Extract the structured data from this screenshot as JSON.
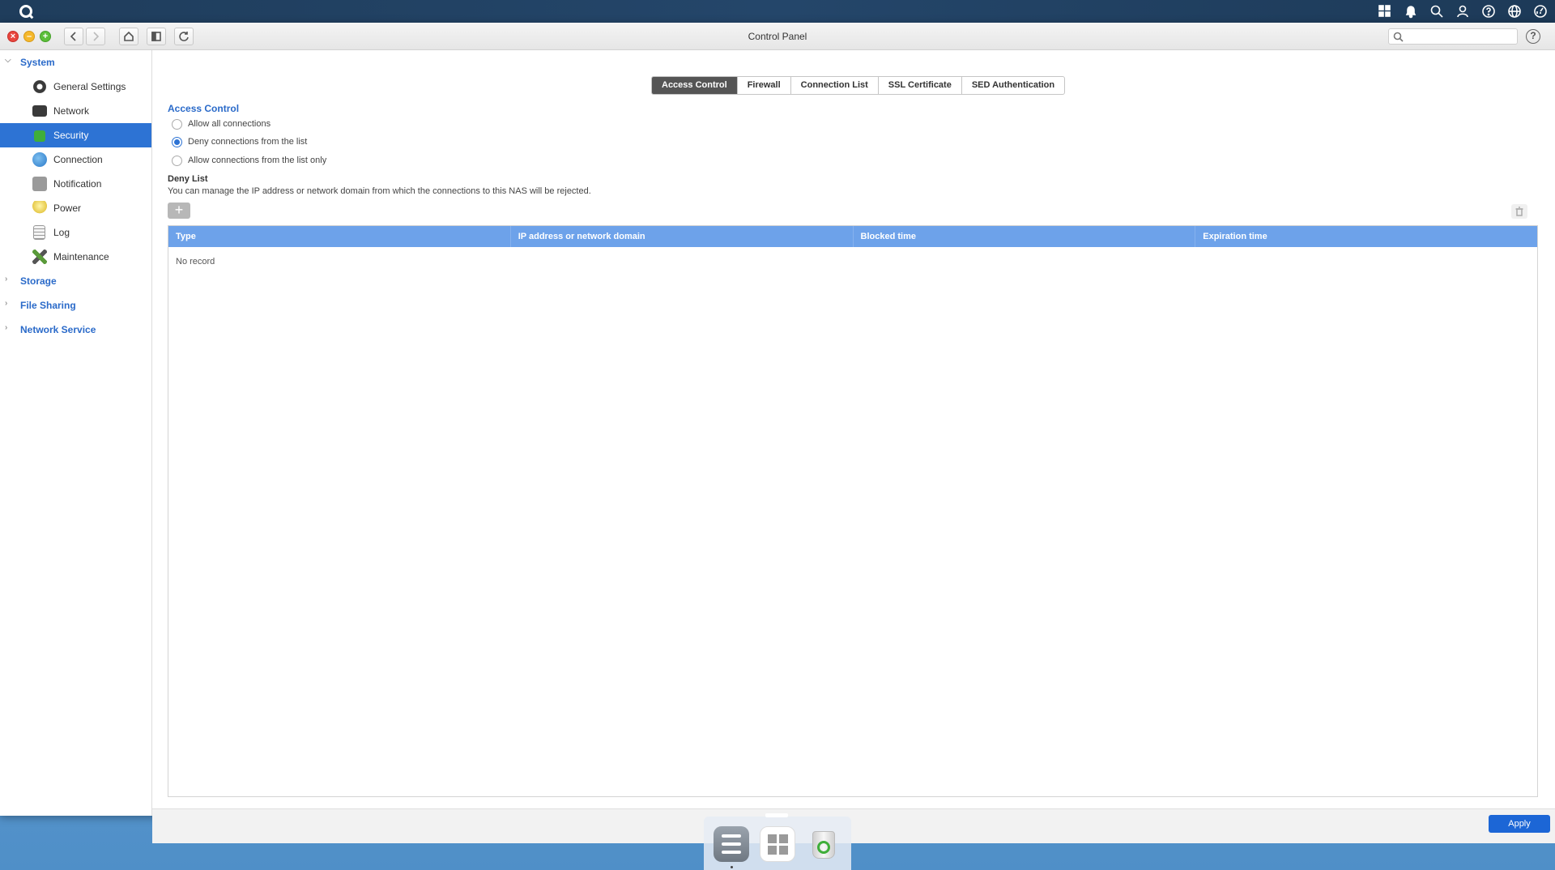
{
  "window": {
    "title": "Control Panel"
  },
  "sidebar": {
    "groups": [
      {
        "label": "System",
        "expanded": true
      },
      {
        "label": "Storage",
        "expanded": false
      },
      {
        "label": "File Sharing",
        "expanded": false
      },
      {
        "label": "Network Service",
        "expanded": false
      }
    ],
    "items": [
      {
        "label": "General Settings",
        "icon": "gear-icon"
      },
      {
        "label": "Network",
        "icon": "network-icon"
      },
      {
        "label": "Security",
        "icon": "lock-icon",
        "active": true
      },
      {
        "label": "Connection",
        "icon": "globe-icon"
      },
      {
        "label": "Notification",
        "icon": "bell-icon"
      },
      {
        "label": "Power",
        "icon": "bulb-icon"
      },
      {
        "label": "Log",
        "icon": "log-icon"
      },
      {
        "label": "Maintenance",
        "icon": "tools-icon"
      }
    ]
  },
  "tabs": [
    {
      "label": "Access Control",
      "active": true
    },
    {
      "label": "Firewall"
    },
    {
      "label": "Connection List"
    },
    {
      "label": "SSL Certificate"
    },
    {
      "label": "SED Authentication"
    }
  ],
  "access_control": {
    "title": "Access Control",
    "options": [
      {
        "label": "Allow all connections",
        "selected": false
      },
      {
        "label": "Deny connections from the list",
        "selected": true
      },
      {
        "label": "Allow connections from the list only",
        "selected": false
      }
    ]
  },
  "deny_list": {
    "title": "Deny List",
    "description": "You can manage the IP address or network domain from which the connections to this NAS will be rejected.",
    "columns": [
      "Type",
      "IP address or network domain",
      "Blocked time",
      "Expiration time"
    ],
    "empty_text": "No record"
  },
  "footer": {
    "apply_label": "Apply"
  },
  "colors": {
    "accent": "#2d73d4",
    "header": "#6da2ea",
    "apply": "#1c66d6"
  }
}
